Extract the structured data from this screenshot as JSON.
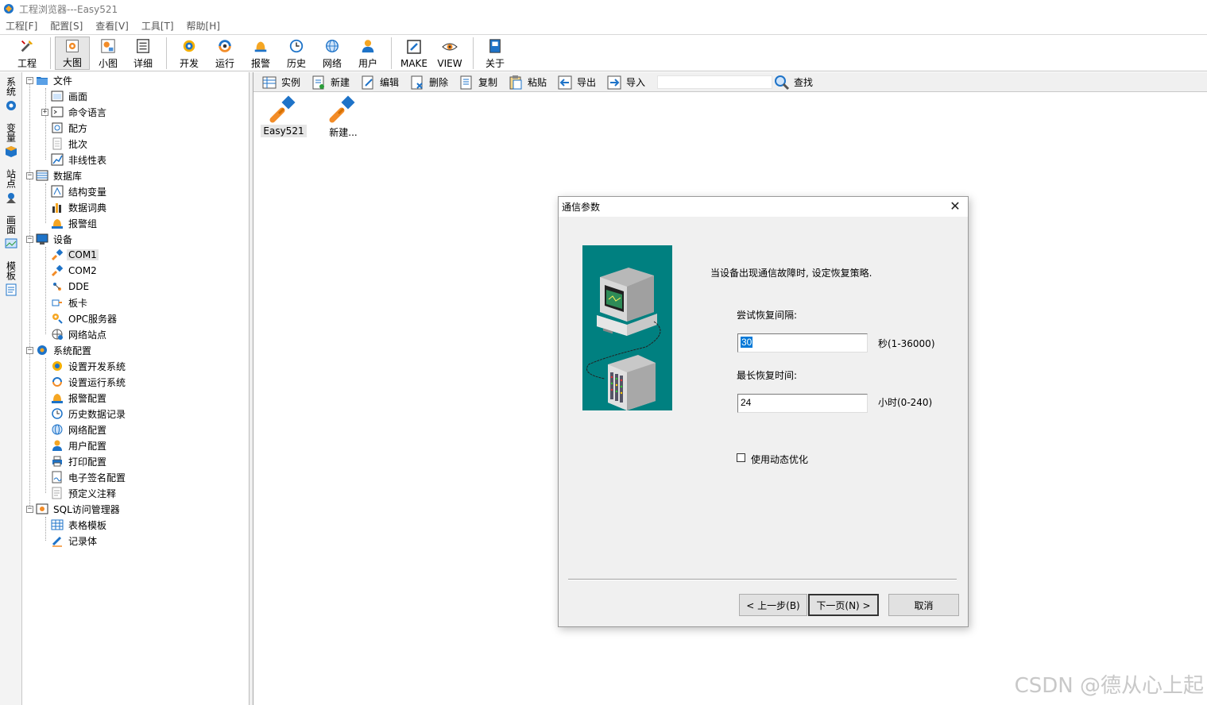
{
  "window": {
    "title": "工程浏览器---Easy521"
  },
  "menu": [
    "工程[F]",
    "配置[S]",
    "查看[V]",
    "工具[T]",
    "帮助[H]"
  ],
  "toolbar": {
    "project": "工程",
    "large_icons": "大图",
    "small_icons": "小图",
    "details": "详细",
    "develop": "开发",
    "run": "运行",
    "alarm": "报警",
    "history": "历史",
    "network": "网络",
    "user": "用户",
    "make": "MAKE",
    "view": "VIEW",
    "about": "关于"
  },
  "vtabs": [
    "系统",
    "变量",
    "站点",
    "画面",
    "模板"
  ],
  "tree": {
    "file": "文件",
    "screen": "画面",
    "command_lang": "命令语言",
    "recipe": "配方",
    "batch": "批次",
    "nonlinear": "非线性表",
    "database": "数据库",
    "struct_var": "结构变量",
    "data_dict": "数据词典",
    "alarm_group": "报警组",
    "devices": "设备",
    "com1": "COM1",
    "com2": "COM2",
    "dde": "DDE",
    "board": "板卡",
    "opc": "OPC服务器",
    "net_station": "网络站点",
    "sys_config": "系统配置",
    "set_dev_sys": "设置开发系统",
    "set_run_sys": "设置运行系统",
    "alarm_config": "报警配置",
    "history_record": "历史数据记录",
    "net_config": "网络配置",
    "user_config": "用户配置",
    "print_config": "打印配置",
    "esign_config": "电子签名配置",
    "predefined_notes": "预定义注释",
    "sql_manager": "SQL访问管理器",
    "table_template": "表格模板",
    "recordset": "记录体"
  },
  "subtoolbar": {
    "instance": "实例",
    "new": "新建",
    "edit": "编辑",
    "delete": "删除",
    "copy": "复制",
    "paste": "粘贴",
    "export": "导出",
    "import": "导入",
    "search_value": "",
    "find": "查找"
  },
  "devices_view": [
    "Easy521",
    "新建..."
  ],
  "dialog": {
    "title": "通信参数",
    "close": "✕",
    "description": "当设备出现通信故障时, 设定恢复策略.",
    "retry_label": "尝试恢复间隔:",
    "retry_value": "30",
    "retry_unit": "秒(1-36000)",
    "max_label": "最长恢复时间:",
    "max_value": "24",
    "max_unit": "小时(0-240)",
    "dynamic_opt": "使用动态优化",
    "dynamic_opt_checked": false,
    "prev": "< 上一步(B)",
    "next": "下一页(N) >",
    "cancel": "取消"
  },
  "watermark": "CSDN @德从心上起"
}
